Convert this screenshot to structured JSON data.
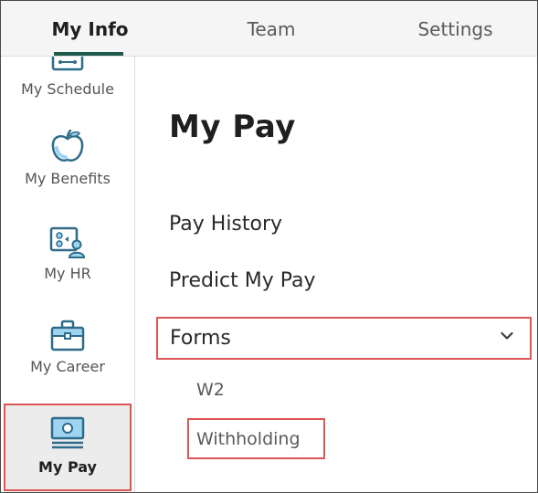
{
  "tabs": [
    {
      "label": "My Info",
      "active": true
    },
    {
      "label": "Team",
      "active": false
    },
    {
      "label": "Settings",
      "active": false
    }
  ],
  "sidebar": {
    "items": [
      {
        "label": "My Schedule",
        "icon": "calendar-icon"
      },
      {
        "label": "My Benefits",
        "icon": "apple-icon"
      },
      {
        "label": "My HR",
        "icon": "hr-board-icon"
      },
      {
        "label": "My Career",
        "icon": "briefcase-icon"
      },
      {
        "label": "My Pay",
        "icon": "pay-icon",
        "active": true
      }
    ]
  },
  "main": {
    "title": "My Pay",
    "links": [
      {
        "label": "Pay History"
      },
      {
        "label": "Predict My Pay"
      }
    ],
    "forms": {
      "label": "Forms",
      "expanded": true,
      "items": [
        {
          "label": "W2"
        },
        {
          "label": "Withholding"
        }
      ]
    }
  },
  "colors": {
    "accent": "#1f5c4e",
    "highlight": "#e05555",
    "icon_teal": "#2e6b8a",
    "icon_light": "#9fd4f0"
  }
}
